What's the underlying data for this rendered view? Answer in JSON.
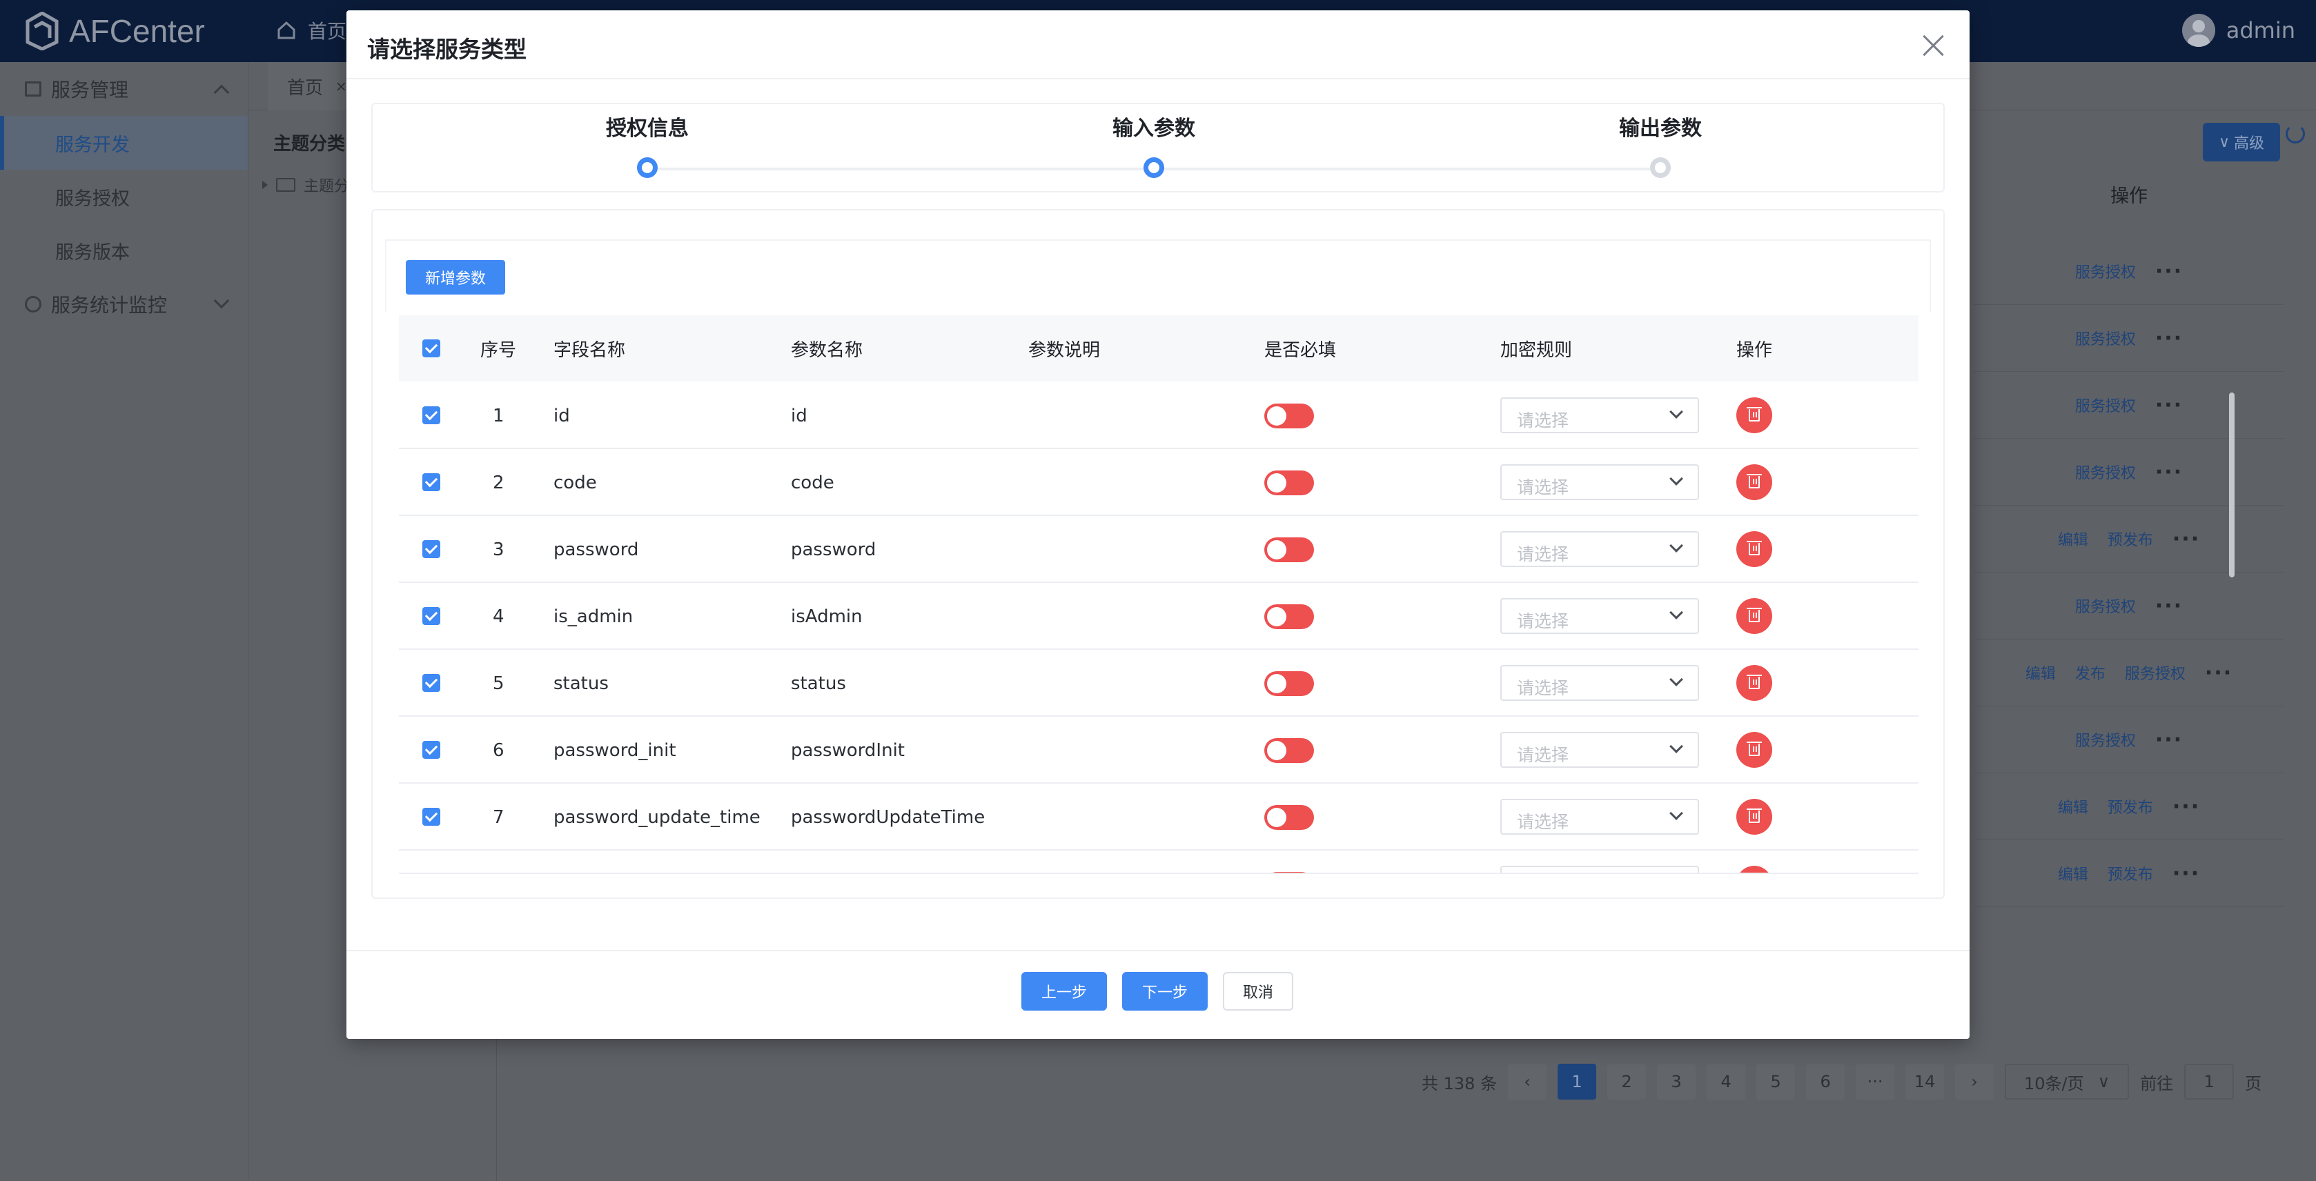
{
  "app": {
    "name": "AFCenter",
    "home_label": "首页",
    "user": "admin"
  },
  "sidebar": {
    "groups": [
      {
        "label": "服务管理",
        "items": [
          "服务开发",
          "服务授权",
          "服务版本"
        ]
      },
      {
        "label": "服务统计监控",
        "items": []
      }
    ],
    "active_item": "服务开发"
  },
  "tabs": [
    {
      "label": "首页",
      "close": "×"
    }
  ],
  "tree": {
    "title": "主题分类",
    "root": "主题分"
  },
  "background_table": {
    "advanced_button": "高级",
    "ops_header": "操作",
    "rows": [
      [
        "服务授权"
      ],
      [
        "服务授权"
      ],
      [
        "服务授权"
      ],
      [
        "服务授权"
      ],
      [
        "编辑",
        "预发布"
      ],
      [
        "服务授权"
      ],
      [
        "编辑",
        "发布",
        "服务授权"
      ],
      [
        "服务授权"
      ],
      [
        "编辑",
        "预发布"
      ],
      [
        "编辑",
        "预发布"
      ]
    ],
    "more": "···"
  },
  "pagination": {
    "total": "共 138 条",
    "pages": [
      "1",
      "2",
      "3",
      "4",
      "5",
      "6",
      "···",
      "14"
    ],
    "current": "1",
    "prev": "‹",
    "next": "›",
    "page_size": "10条/页",
    "goto_label": "前往",
    "goto_value": "1",
    "page_unit": "页"
  },
  "modal": {
    "title": "请选择服务类型",
    "steps": [
      {
        "label": "授权信息",
        "state": "done"
      },
      {
        "label": "输入参数",
        "state": "active"
      },
      {
        "label": "输出参数",
        "state": "wait"
      }
    ],
    "add_button": "新增参数",
    "columns": {
      "index": "序号",
      "field": "字段名称",
      "param": "参数名称",
      "desc": "参数说明",
      "required": "是否必填",
      "encrypt": "加密规则",
      "ops": "操作"
    },
    "select_placeholder": "请选择",
    "rows": [
      {
        "index": "1",
        "field": "id",
        "param": "id",
        "desc": ""
      },
      {
        "index": "2",
        "field": "code",
        "param": "code",
        "desc": ""
      },
      {
        "index": "3",
        "field": "password",
        "param": "password",
        "desc": ""
      },
      {
        "index": "4",
        "field": "is_admin",
        "param": "isAdmin",
        "desc": ""
      },
      {
        "index": "5",
        "field": "status",
        "param": "status",
        "desc": ""
      },
      {
        "index": "6",
        "field": "password_init",
        "param": "passwordInit",
        "desc": ""
      },
      {
        "index": "7",
        "field": "password_update_time",
        "param": "passwordUpdateTime",
        "desc": ""
      }
    ],
    "footer": {
      "prev": "上一步",
      "next": "下一步",
      "cancel": "取消"
    }
  },
  "colors": {
    "primary": "#3f89f5",
    "danger": "#ee4f4f",
    "header_bg": "#0b1c3a"
  }
}
